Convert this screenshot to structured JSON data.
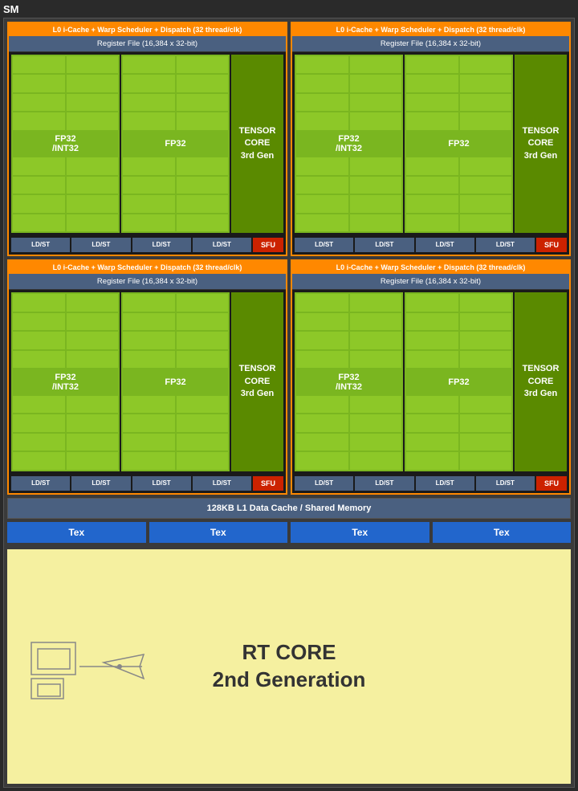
{
  "sm_label": "SM",
  "l0_header": "L0 i-Cache + Warp Scheduler + Dispatch (32 thread/clk)",
  "register_file": "Register File (16,384 x 32-bit)",
  "fp32_int32_label": "FP32\n/\nINT32",
  "fp32_label": "FP32",
  "tensor_label": "TENSOR\nCORE\n3rd Gen",
  "ld_st": "LD/ST",
  "sfu": "SFU",
  "l1_cache": "128KB L1 Data Cache / Shared Memory",
  "tex_label": "Tex",
  "rt_core_line1": "RT CORE",
  "rt_core_line2": "2nd Generation",
  "sub_partitions": [
    {
      "id": "top-left"
    },
    {
      "id": "top-right"
    },
    {
      "id": "bottom-left"
    },
    {
      "id": "bottom-right"
    }
  ]
}
